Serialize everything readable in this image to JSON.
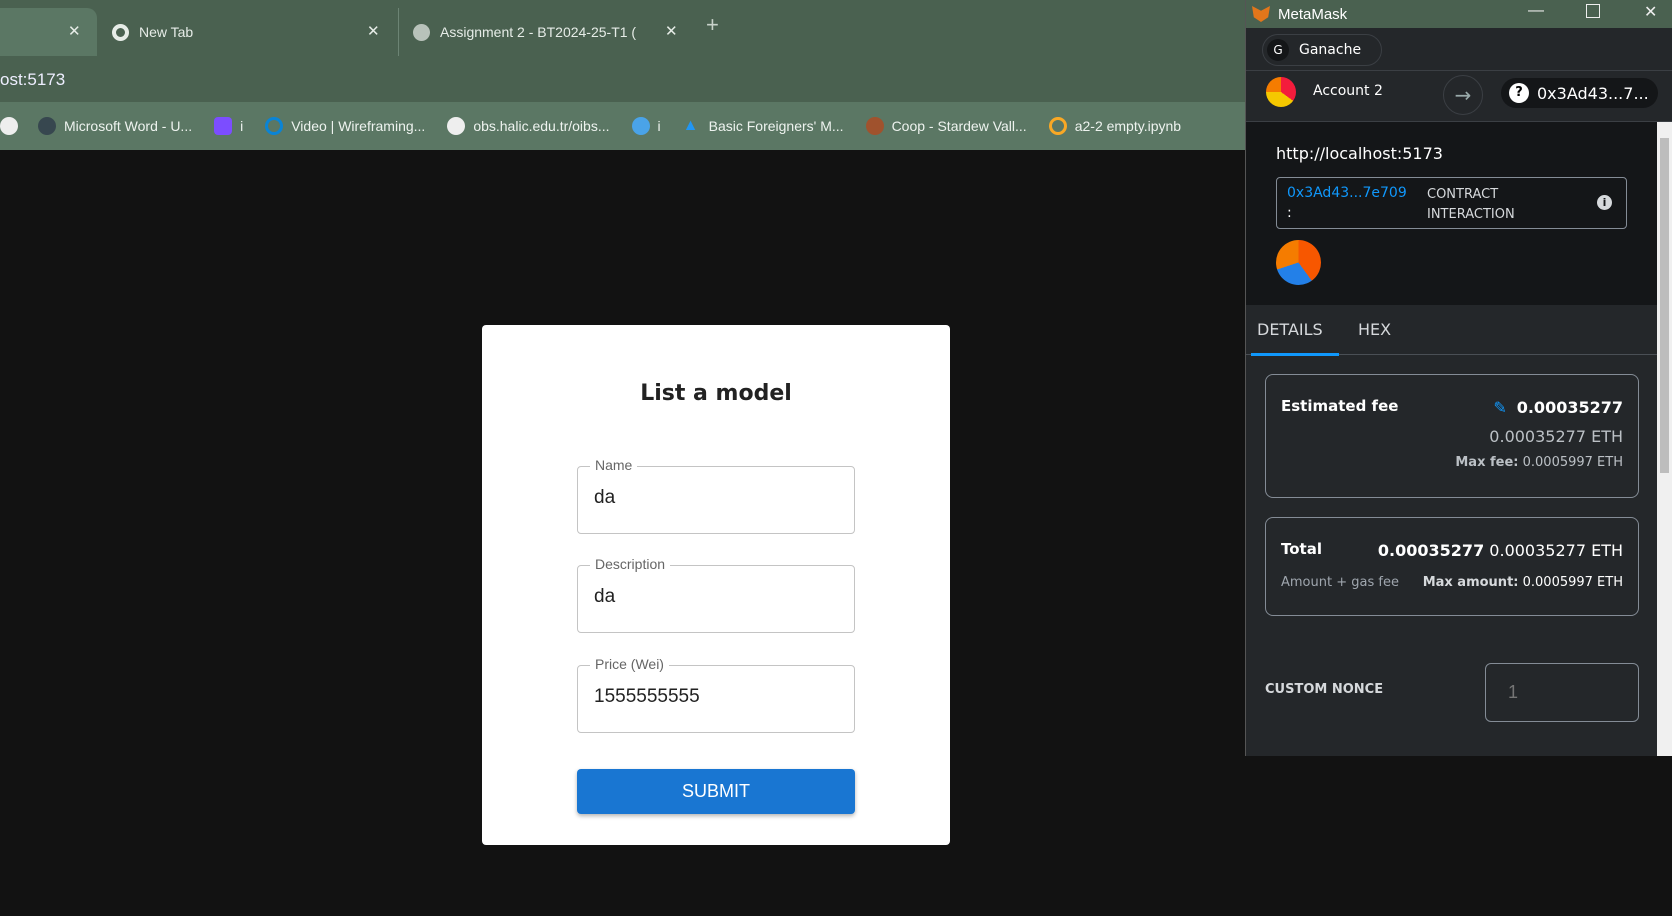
{
  "browser": {
    "tabs": [
      {
        "label": ""
      },
      {
        "label": "New Tab"
      },
      {
        "label": "Assignment 2 - BT2024-25-T1 ("
      }
    ],
    "new_tab": "+",
    "address": "ost:5173",
    "bookmarks": [
      {
        "label": "",
        "icon": "globe-icon"
      },
      {
        "label": "Microsoft Word - U...",
        "icon": "word-icon"
      },
      {
        "label": "i",
        "icon": "app-icon"
      },
      {
        "label": "Video | Wireframing...",
        "icon": "ring-icon"
      },
      {
        "label": "obs.halic.edu.tr/oibs...",
        "icon": "globe-icon"
      },
      {
        "label": "i",
        "icon": "mail-icon"
      },
      {
        "label": "Basic Foreigners' M...",
        "icon": "triangle-icon"
      },
      {
        "label": "Coop - Stardew Vall...",
        "icon": "chicken-icon"
      },
      {
        "label": "a2-2 empty.ipynb",
        "icon": "colab-icon"
      }
    ]
  },
  "form": {
    "title": "List a model",
    "fields": [
      {
        "label": "Name",
        "value": "da"
      },
      {
        "label": "Description",
        "value": "da"
      },
      {
        "label": "Price (Wei)",
        "value": "1555555555"
      }
    ],
    "submit": "SUBMIT",
    "accent": "#1976d2"
  },
  "metamask": {
    "title": "MetaMask",
    "network": {
      "letter": "G",
      "name": "Ganache"
    },
    "account": "Account 2",
    "recipient": "0x3Ad43...7...",
    "origin": "http://localhost:5173",
    "contract_address": "0x3Ad43...7e709",
    "contract_colon": ":",
    "contract_label": "CONTRACT INTERACTION",
    "tabs": [
      "DETAILS",
      "HEX"
    ],
    "active_tab": "DETAILS",
    "fee": {
      "label": "Estimated fee",
      "primary": "0.00035277",
      "secondary": "0.00035277 ETH",
      "max_label": "Max fee:",
      "max_value": "0.0005997 ETH"
    },
    "total": {
      "label": "Total",
      "primary": "0.00035277",
      "secondary": "0.00035277 ETH",
      "sub_label": "Amount + gas fee",
      "max_label": "Max amount:",
      "max_value": "0.0005997 ETH"
    },
    "nonce": {
      "label": "CUSTOM NONCE",
      "placeholder": "1"
    },
    "link_color": "#1098fc"
  }
}
